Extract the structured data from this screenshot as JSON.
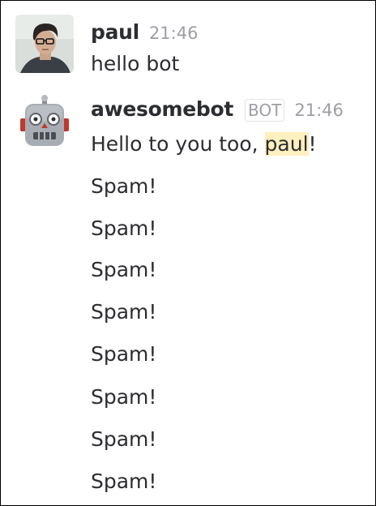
{
  "messages": [
    {
      "user": "paul",
      "time": "21:46",
      "text": "hello bot",
      "avatar_icon": "user-photo-avatar"
    },
    {
      "user": "awesomebot",
      "badge": "BOT",
      "time": "21:46",
      "text_before": "Hello to you too, ",
      "mention": "paul",
      "text_after": "!",
      "avatar_icon": "robot-face-icon",
      "spam": [
        "Spam!",
        "Spam!",
        "Spam!",
        "Spam!",
        "Spam!",
        "Spam!",
        "Spam!",
        "Spam!"
      ]
    }
  ],
  "colors": {
    "text": "#2c2d30",
    "muted": "#9e9ea6",
    "mention_highlight": "#fff0bf"
  }
}
